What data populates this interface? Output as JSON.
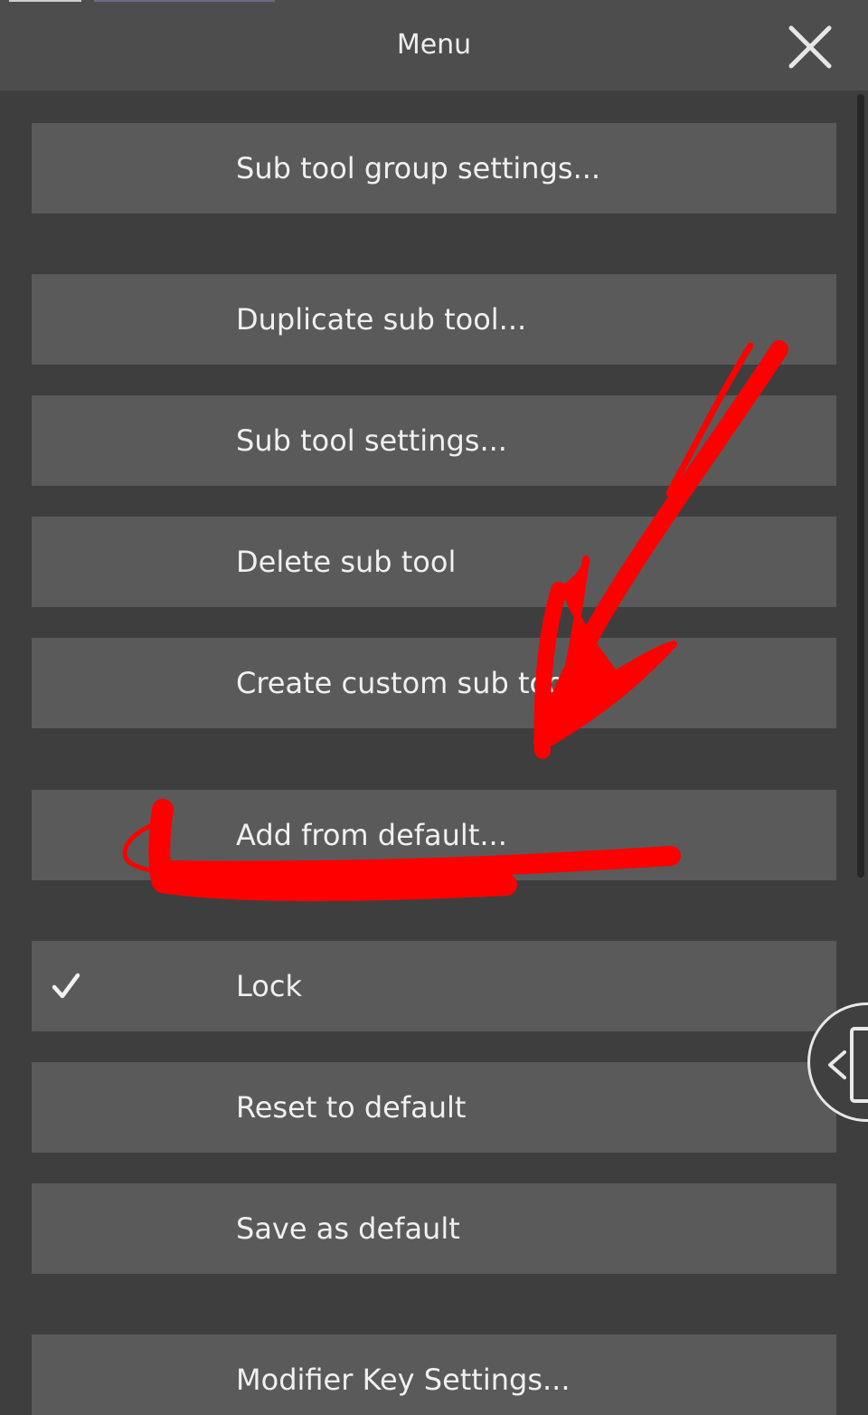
{
  "header": {
    "title": "Menu",
    "close_icon": "close-icon"
  },
  "menu": {
    "items": [
      {
        "label": "Sub tool group settings...",
        "checked": false
      },
      {
        "label": "Duplicate sub tool...",
        "checked": false
      },
      {
        "label": "Sub tool settings...",
        "checked": false
      },
      {
        "label": "Delete sub tool",
        "checked": false
      },
      {
        "label": "Create custom sub tool",
        "checked": false
      },
      {
        "label": "Add from default...",
        "checked": false
      },
      {
        "label": "Lock",
        "checked": true
      },
      {
        "label": "Reset to default",
        "checked": false
      },
      {
        "label": "Save as default",
        "checked": false
      },
      {
        "label": "Modifier Key Settings...",
        "checked": false
      }
    ]
  },
  "icons": {
    "check": "check-icon",
    "side_handle": "chevron-left-icon"
  },
  "colors": {
    "background": "#3e3e3e",
    "header": "#4d4d4d",
    "menu_item": "#5a5a5a",
    "text": "#f0f0f0",
    "annotation": "#ff0000"
  }
}
